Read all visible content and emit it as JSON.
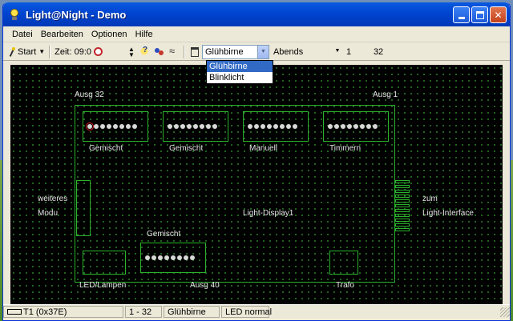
{
  "window": {
    "title": "Light@Night - Demo"
  },
  "menu": [
    "Datei",
    "Bearbeiten",
    "Optionen",
    "Hilfe"
  ],
  "toolbar": {
    "start_label": "Start",
    "zeit_label": "Zeit: 09:0",
    "lamp_type": "Glühbirne",
    "mode": "Abends",
    "num1": "1",
    "num2": "32"
  },
  "dropdown": {
    "options": [
      "Glühbirne",
      "Blinklicht"
    ],
    "selected_index": 0
  },
  "canvas": {
    "ausg_32": "Ausg 32",
    "ausg_1": "Ausg 1",
    "groups": [
      "Gemischt",
      "Gemischt",
      "Manuell",
      "Timmern"
    ],
    "weiteres": "weiteres",
    "modu": "Modu",
    "display": "Light-Display1",
    "zum": "zum",
    "interface": "Light-Interface",
    "gemischt_bottom": "Gemischt",
    "led_lampen": "LED/Lampen",
    "ausg_40": "Ausg 40",
    "trafo": "Trafo"
  },
  "status": {
    "device": "T1 (0x37E)",
    "range": "1 - 32",
    "type": "Glühbirne",
    "mode": "LED normal"
  },
  "icons": [
    "app-bulb-icon",
    "wand-icon",
    "clock-icon",
    "spin-icon",
    "help-icon",
    "people-icon",
    "wave-icon",
    "trash-icon"
  ],
  "colors": {
    "titlebar": "#0044d0",
    "canvas_bg": "#000000",
    "grid_green": "#2bb32b",
    "selection": "#316ac5"
  }
}
